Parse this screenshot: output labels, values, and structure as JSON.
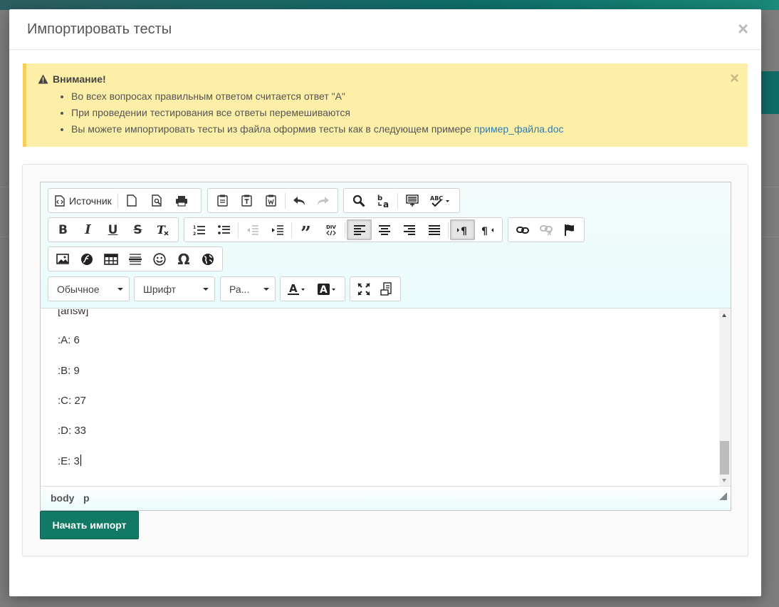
{
  "modal": {
    "title": "Импортировать тесты",
    "close": "×"
  },
  "alert": {
    "heading": "Внимание!",
    "close": "×",
    "items": [
      "Во всех вопросах правильным ответом считается ответ \"А\"",
      "При проведении тестирования все ответы перемешиваются",
      "Вы можете импортировать тесты из файла оформив тесты как в следующем примере "
    ],
    "link": "пример_файла.doc"
  },
  "toolbar": {
    "source_label": "Источник",
    "format_combo": "Обычное",
    "font_combo": "Шрифт",
    "size_combo": "Ра..."
  },
  "editor": {
    "lines": [
      "[answ]",
      ":A: 6",
      ":B: 9",
      ":C: 27",
      ":D: 33",
      ":E: 3"
    ]
  },
  "statusbar": {
    "path": [
      "body",
      "p"
    ]
  },
  "actions": {
    "import": "Начать импорт"
  }
}
